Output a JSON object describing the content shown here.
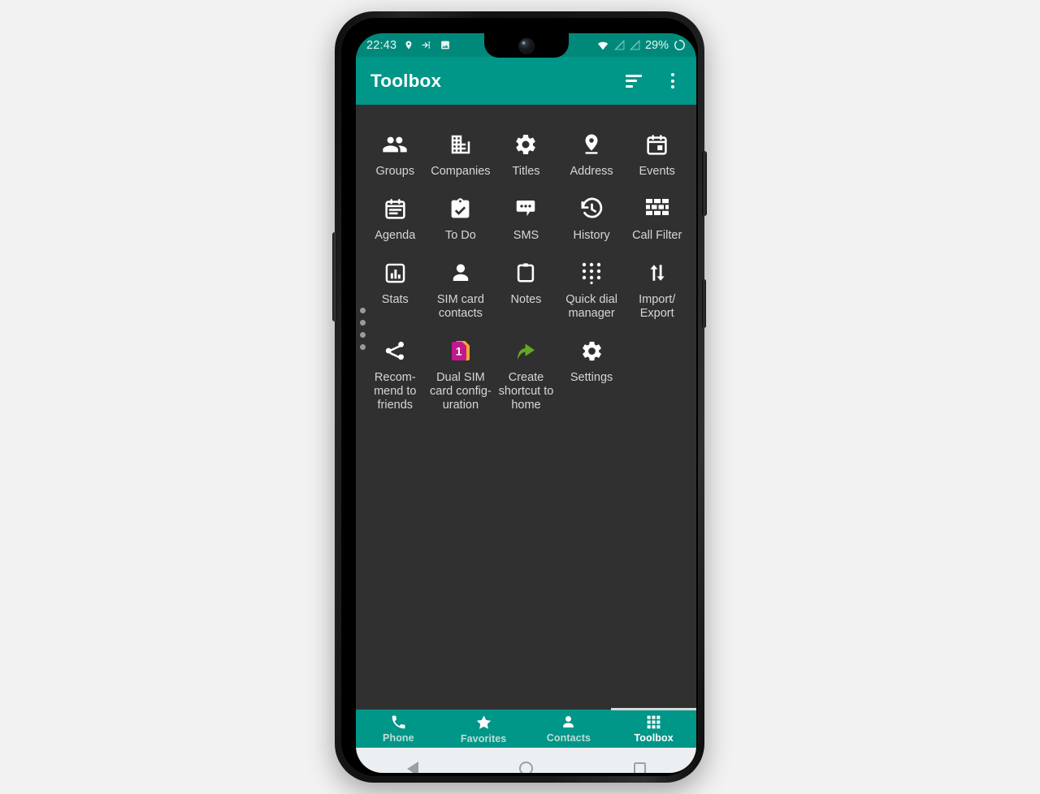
{
  "status_bar": {
    "clock": "22:43",
    "battery_percent": "29%",
    "left_icons": [
      "location-pin-icon",
      "login-arrow-icon",
      "image-icon"
    ],
    "right_icons": [
      "wifi-icon",
      "signal-off-1-icon",
      "signal-off-2-icon",
      "battery-circle-icon"
    ],
    "background_color": "#00897b"
  },
  "app_bar": {
    "title": "Toolbox",
    "sort_icon": "sort-icon",
    "overflow_icon": "overflow-menu-icon",
    "background_color": "#009688"
  },
  "content": {
    "background_color": "#303030",
    "scroll_dots": 4,
    "tools": [
      {
        "label": "Groups",
        "icon": "people-icon"
      },
      {
        "label": "Companies",
        "icon": "building-icon"
      },
      {
        "label": "Titles",
        "icon": "gear-icon"
      },
      {
        "label": "Address",
        "icon": "location-pin-icon"
      },
      {
        "label": "Events",
        "icon": "calendar-event-icon"
      },
      {
        "label": "Agenda",
        "icon": "calendar-agenda-icon"
      },
      {
        "label": "To Do",
        "icon": "clipboard-check-icon"
      },
      {
        "label": "SMS",
        "icon": "chat-bubble-icon"
      },
      {
        "label": "History",
        "icon": "history-clock-icon"
      },
      {
        "label": "Call Filter",
        "icon": "brick-grid-icon"
      },
      {
        "label": "Stats",
        "icon": "bar-chart-icon"
      },
      {
        "label": "SIM card contacts",
        "icon": "person-icon"
      },
      {
        "label": "Notes",
        "icon": "clipboard-icon"
      },
      {
        "label": "Quick dial manager",
        "icon": "dialpad-icon"
      },
      {
        "label": "Import/ Export",
        "icon": "import-export-arrows-icon"
      },
      {
        "label": "Recom- mend to friends",
        "icon": "share-icon"
      },
      {
        "label": "Dual SIM card config- uration",
        "icon": "dual-sim-card-icon"
      },
      {
        "label": "Create shortcut to home",
        "icon": "green-curved-arrow-icon"
      },
      {
        "label": "Settings",
        "icon": "gear-icon"
      }
    ],
    "dual_sim_badge": "1",
    "dual_sim_colors": {
      "front": "#c2178f",
      "back": "#f5a623"
    },
    "shortcut_arrow_color": "#6aa526"
  },
  "bottom_nav": {
    "tabs": [
      {
        "label": "Phone",
        "icon": "phone-icon",
        "active": false
      },
      {
        "label": "Favorites",
        "icon": "star-icon",
        "active": false
      },
      {
        "label": "Contacts",
        "icon": "person-icon",
        "active": false
      },
      {
        "label": "Toolbox",
        "icon": "grid-apps-icon",
        "active": true
      }
    ],
    "active_indicator_color": "#d8d8d8"
  },
  "android_nav": {
    "keys": [
      "back-key",
      "home-key",
      "recents-key"
    ],
    "background_color": "#eceff1"
  }
}
